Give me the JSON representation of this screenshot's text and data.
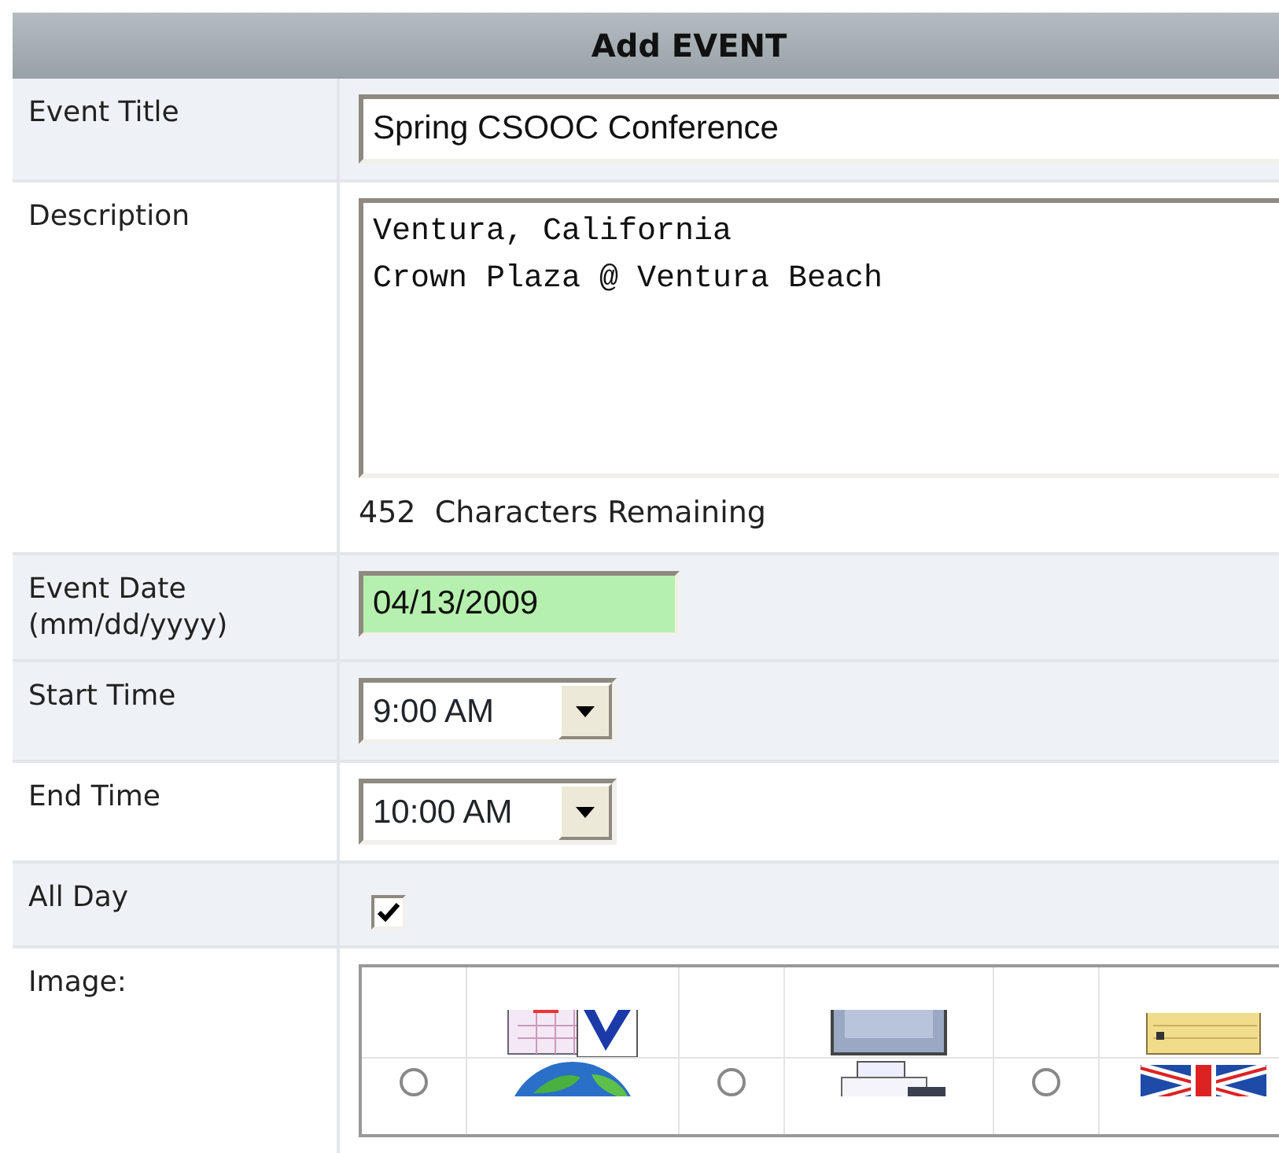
{
  "header": {
    "title": "Add EVENT"
  },
  "fields": [
    {
      "kind": "text",
      "label": "Event Title",
      "value": "Spring CSOOC Conference"
    },
    {
      "kind": "textarea",
      "label": "Description",
      "value": "Ventura, California\nCrown Plaza @ Ventura Beach",
      "counter": "452",
      "counter_label": "Characters Remaining"
    },
    {
      "kind": "date",
      "label": "Event Date (mm/dd/yyyy)",
      "value": "04/13/2009",
      "highlighted": true
    },
    {
      "kind": "select",
      "label": "Start Time",
      "value": "9:00 AM"
    },
    {
      "kind": "select",
      "label": "End Time",
      "value": "10:00 AM"
    },
    {
      "kind": "checkbox",
      "label": "All Day",
      "checked": true
    },
    {
      "kind": "images",
      "label": "Image:",
      "options": [
        {
          "selected": false
        },
        {
          "selected": false
        },
        {
          "selected": false
        }
      ]
    }
  ]
}
